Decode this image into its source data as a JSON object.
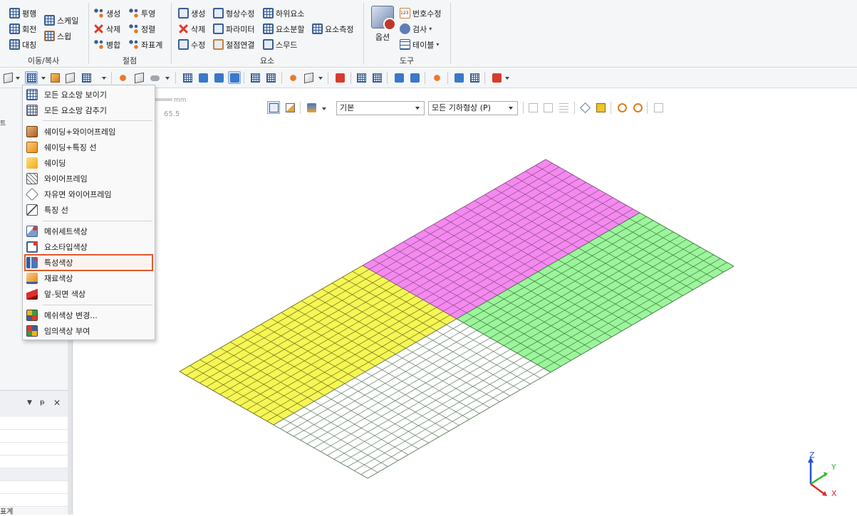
{
  "ribbon": {
    "groups": [
      {
        "label": "이동/복사",
        "items": [
          {
            "label": "평행",
            "icon": "move-icon"
          },
          {
            "label": "회전",
            "icon": "rotate-icon"
          },
          {
            "label": "대칭",
            "icon": "mirror-icon"
          },
          {
            "label": "스케일",
            "icon": "scale-icon"
          },
          {
            "label": "스윕",
            "icon": "sweep-icon"
          }
        ]
      },
      {
        "label": "절점",
        "items": [
          {
            "label": "생성",
            "icon": "node-create-icon"
          },
          {
            "label": "삭제",
            "icon": "node-delete-icon"
          },
          {
            "label": "병합",
            "icon": "node-merge-icon"
          },
          {
            "label": "투영",
            "icon": "node-project-icon"
          },
          {
            "label": "정렬",
            "icon": "node-align-icon"
          },
          {
            "label": "좌표계",
            "icon": "coordinate-system-icon"
          }
        ]
      },
      {
        "label": "요소",
        "items": [
          {
            "label": "생성",
            "icon": "element-create-icon"
          },
          {
            "label": "삭제",
            "icon": "element-delete-icon"
          },
          {
            "label": "수정",
            "icon": "element-modify-icon"
          },
          {
            "label": "형상수정",
            "icon": "shape-modify-icon"
          },
          {
            "label": "파라미터",
            "icon": "parameter-icon"
          },
          {
            "label": "절점연결",
            "icon": "node-connect-icon"
          },
          {
            "label": "하위요소",
            "icon": "sub-element-icon"
          },
          {
            "label": "요소분할",
            "icon": "element-split-icon"
          },
          {
            "label": "스무드",
            "icon": "smooth-icon"
          },
          {
            "label": "요소측정",
            "icon": "element-measure-icon"
          }
        ]
      },
      {
        "label": "도구",
        "items": [
          {
            "label": "옵션",
            "icon": "options-icon"
          },
          {
            "label": "번호수정",
            "icon": "renumber-icon"
          },
          {
            "label": "검사",
            "icon": "check-icon"
          },
          {
            "label": "테이블",
            "icon": "table-icon"
          }
        ]
      }
    ]
  },
  "viewport": {
    "unit": "mm",
    "scale_value": "65.5",
    "view_style": "기본",
    "geometry_filter": "모든 기하형상 (P)",
    "axes": {
      "z": "Z",
      "y": "Y",
      "x": "X"
    }
  },
  "mesh": {
    "colors": {
      "pink": "#f589f0",
      "green": "#9cf59c",
      "yellow": "#f6f655",
      "white": "#ffffff",
      "pink_line": "#8a4f87",
      "green_line": "#3d7a3d",
      "yellow_line": "#6e6e1c",
      "white_line": "#5e7a5e"
    }
  },
  "menu": {
    "items": [
      {
        "label": "모든 요소망 보이기",
        "icon": "mesh-show-all-icon"
      },
      {
        "label": "모든 요소망 감추기",
        "icon": "mesh-hide-all-icon"
      },
      {
        "label": "쉐이딩+와이어프레임",
        "icon": "shading-wireframe-icon"
      },
      {
        "label": "쉐이딩+특징 선",
        "icon": "shading-feature-line-icon"
      },
      {
        "label": "쉐이딩",
        "icon": "shading-icon"
      },
      {
        "label": "와이어프레임",
        "icon": "wireframe-icon"
      },
      {
        "label": "자유면 와이어프레임",
        "icon": "free-face-wireframe-icon"
      },
      {
        "label": "특징 선",
        "icon": "feature-line-icon"
      },
      {
        "label": "메쉬세트색상",
        "icon": "mesh-set-color-icon"
      },
      {
        "label": "요소타입색상",
        "icon": "element-type-color-icon"
      },
      {
        "label": "특성색상",
        "icon": "property-color-icon"
      },
      {
        "label": "재료색상",
        "icon": "material-color-icon"
      },
      {
        "label": "앞-뒷면 색상",
        "icon": "front-back-color-icon"
      },
      {
        "label": "메쉬색상 변경...",
        "icon": "mesh-color-change-icon"
      },
      {
        "label": "임의색상 부여",
        "icon": "random-color-icon"
      }
    ],
    "highlighted": "특성색상"
  },
  "left_panel": {
    "bottom_label": "표계"
  }
}
